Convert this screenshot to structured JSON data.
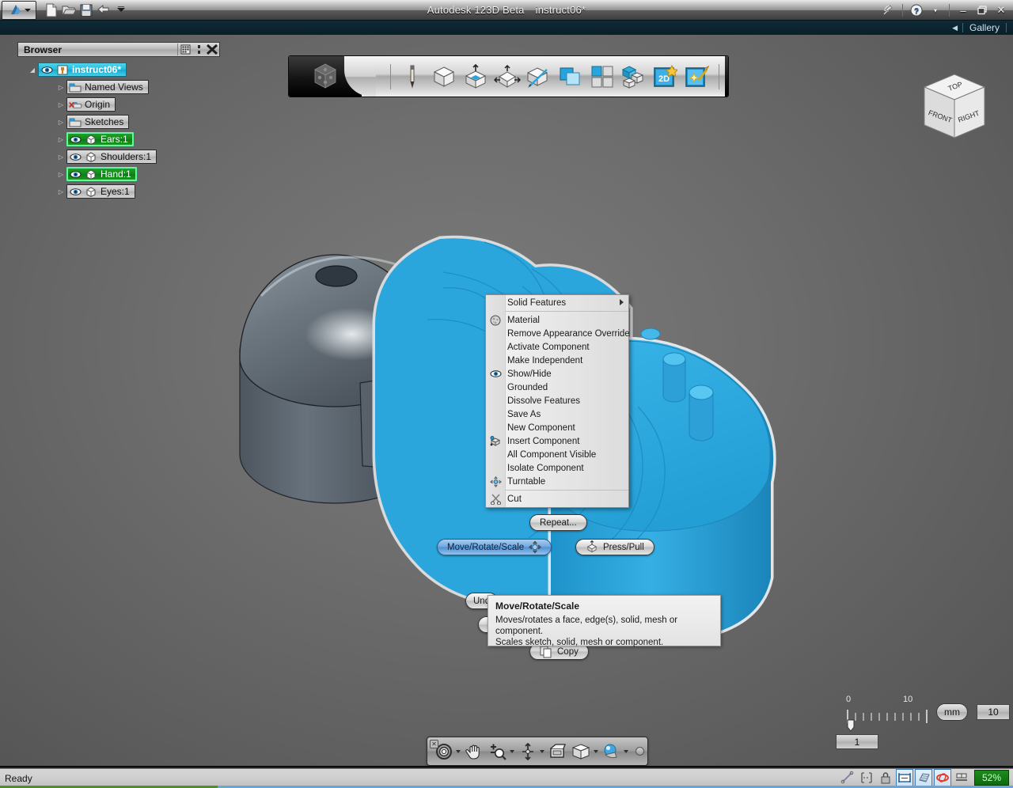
{
  "titlebar": {
    "app_name": "Autodesk 123D Beta",
    "document": "instruct06*",
    "quick_access": [
      {
        "name": "app-menu-button",
        "label": "A"
      },
      {
        "name": "new-document-icon",
        "label": "New"
      },
      {
        "name": "open-document-icon",
        "label": "Open"
      },
      {
        "name": "save-document-icon",
        "label": "Save"
      },
      {
        "name": "undo-icon",
        "label": "Undo"
      },
      {
        "name": "customize-dropdown-icon",
        "label": "Customize"
      }
    ],
    "right_controls": [
      {
        "name": "share-icon",
        "label": "Share"
      },
      {
        "name": "help-icon",
        "label": "?"
      },
      {
        "name": "help-dropdown-icon",
        "label": "▾"
      },
      {
        "name": "minimize-button",
        "label": "–"
      },
      {
        "name": "restore-button",
        "label": "❐"
      },
      {
        "name": "close-button",
        "label": "✕"
      }
    ]
  },
  "gallery_bar": {
    "collapse_arrow": "◀",
    "label": "Gallery"
  },
  "browser": {
    "title": "Browser",
    "header_buttons": [
      {
        "name": "browser-filter-icon",
        "label": "Filter"
      },
      {
        "name": "browser-dock-icon",
        "label": "Dock"
      },
      {
        "name": "browser-close-icon",
        "label": "Close"
      }
    ],
    "tree": [
      {
        "label": "instruct06*",
        "state": "selected-cyan",
        "icon": "document-icon",
        "indent": 0,
        "eye": true,
        "expander": "◢"
      },
      {
        "label": "Named Views",
        "state": "normal",
        "icon": "folder-icon",
        "indent": 1,
        "eye": false,
        "expander": "▷"
      },
      {
        "label": "Origin",
        "state": "normal",
        "icon": "origin-folder-icon",
        "indent": 1,
        "eye": false,
        "expander": "▷"
      },
      {
        "label": "Sketches",
        "state": "normal",
        "icon": "folder-icon",
        "indent": 1,
        "eye": false,
        "expander": "▷"
      },
      {
        "label": "Ears:1",
        "state": "selected-green",
        "icon": "component-icon",
        "indent": 1,
        "eye": true,
        "expander": "▷"
      },
      {
        "label": "Shoulders:1",
        "state": "normal",
        "icon": "component-icon",
        "indent": 1,
        "eye": true,
        "expander": "▷"
      },
      {
        "label": "Hand:1",
        "state": "selected-green",
        "icon": "component-icon",
        "indent": 1,
        "eye": true,
        "expander": "▷"
      },
      {
        "label": "Eyes:1",
        "state": "normal",
        "icon": "component-icon",
        "indent": 1,
        "eye": true,
        "expander": "▷"
      }
    ]
  },
  "main_toolbar": {
    "logo": "123d-cube-logo",
    "tools": [
      {
        "name": "sketch-pencil-tool",
        "label": "Sketch"
      },
      {
        "name": "primitives-tool",
        "label": "Primitives"
      },
      {
        "name": "construct-tool",
        "label": "Construct"
      },
      {
        "name": "modify-tool",
        "label": "Modify"
      },
      {
        "name": "pattern-tool",
        "label": "Pattern"
      },
      {
        "name": "combine-tool",
        "label": "Combine"
      },
      {
        "name": "grouping-tool",
        "label": "Grouping"
      },
      {
        "name": "assemble-tool",
        "label": "Assemble"
      },
      {
        "name": "2d-drawing-tool",
        "label": "2D"
      },
      {
        "name": "smart-tool",
        "label": "Smart"
      }
    ]
  },
  "viewcube": {
    "top_face": "TOP",
    "front_face": "FRONT",
    "right_face": "RIGHT"
  },
  "context_menu": {
    "items": [
      {
        "label": "Solid Features",
        "icon": null,
        "submenu": true
      },
      {
        "separator": true
      },
      {
        "label": "Material",
        "icon": "material-sphere-icon",
        "submenu": false
      },
      {
        "label": "Remove Appearance Override",
        "icon": null,
        "submenu": false
      },
      {
        "label": "Activate Component",
        "icon": null,
        "submenu": false
      },
      {
        "label": "Make Independent",
        "icon": null,
        "submenu": false
      },
      {
        "label": "Show/Hide",
        "icon": "eye-icon",
        "submenu": false
      },
      {
        "label": "Grounded",
        "icon": null,
        "submenu": false
      },
      {
        "label": "Dissolve Features",
        "icon": null,
        "submenu": false
      },
      {
        "label": "Save As",
        "icon": null,
        "submenu": false
      },
      {
        "label": "New Component",
        "icon": null,
        "submenu": false
      },
      {
        "label": "Insert Component",
        "icon": "insert-component-icon",
        "submenu": false
      },
      {
        "label": "All Component Visible",
        "icon": null,
        "submenu": false
      },
      {
        "label": "Isolate Component",
        "icon": null,
        "submenu": false
      },
      {
        "label": "Turntable",
        "icon": "turntable-icon",
        "submenu": false
      },
      {
        "separator": true
      },
      {
        "label": "Cut",
        "icon": "scissors-icon",
        "submenu": false
      }
    ]
  },
  "marking_menu": {
    "repeat": "Repeat...",
    "move_rotate_scale": "Move/Rotate/Scale",
    "press_pull": "Press/Pull",
    "undo": "Und",
    "copy": "Copy"
  },
  "tooltip": {
    "title": "Move/Rotate/Scale",
    "line1": "Moves/rotates a face, edge(s), solid, mesh or component.",
    "line2": "Scales sketch, solid, mesh or component."
  },
  "nav_bar": {
    "items": [
      {
        "name": "orbit-tool",
        "label": "Orbit",
        "caret": true
      },
      {
        "name": "pan-tool",
        "label": "Pan",
        "caret": false
      },
      {
        "name": "zoom-tool",
        "label": "Zoom",
        "caret": true
      },
      {
        "name": "fit-tool",
        "label": "Fit",
        "caret": true
      },
      {
        "name": "view-preset-tool",
        "label": "View",
        "caret": false
      },
      {
        "name": "display-style-tool",
        "label": "Display",
        "caret": true
      },
      {
        "name": "appearance-tool",
        "label": "Appearance",
        "caret": true
      }
    ]
  },
  "ruler": {
    "tick_start_label": "0",
    "tick_end_label": "10",
    "unit": "mm",
    "grid_spacing_value": "1",
    "snap_value": "10"
  },
  "status_bar": {
    "message": "Ready",
    "buttons": [
      {
        "name": "snap-line-icon",
        "label": "Line snap",
        "on": false
      },
      {
        "name": "dimension-constraint-icon",
        "label": "Constraint",
        "on": false
      },
      {
        "name": "lock-icon",
        "label": "Lock",
        "on": false
      },
      {
        "name": "grid-snap-icon",
        "label": "Grid snap",
        "on": true
      },
      {
        "name": "grid-display-icon",
        "label": "Grid display",
        "on": true
      },
      {
        "name": "sketch-relevance-icon",
        "label": "Sketch relevance",
        "on": true
      },
      {
        "name": "layer-icon",
        "label": "Layers",
        "on": false
      }
    ],
    "zoom_level": "52%"
  },
  "colors": {
    "selection_blue": "#2ba6dd",
    "model_gray": "#5c6670",
    "accent_green": "#0d8a18",
    "accent_cyan": "#22b9dc",
    "viewport_bg": "#6e6e6e"
  }
}
